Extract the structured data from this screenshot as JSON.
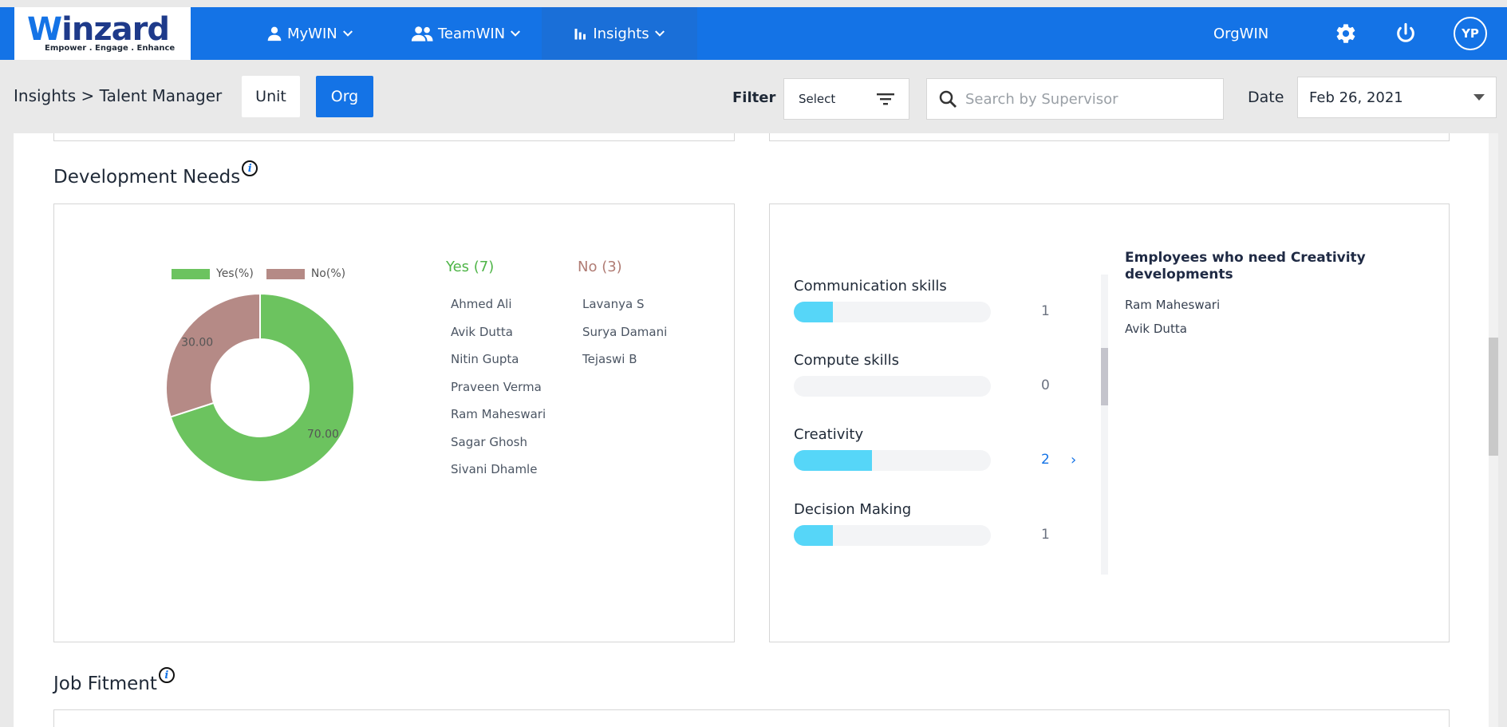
{
  "brand": {
    "name_first": "W",
    "name_rest": "inzard",
    "tagline": "Empower . Engage . Enhance"
  },
  "nav": {
    "mywin": "MyWIN",
    "teamwin": "TeamWIN",
    "insights": "Insights",
    "orgwin": "OrgWIN",
    "avatar_initials": "YP"
  },
  "subheader": {
    "breadcrumb": "Insights > Talent Manager",
    "unit_label": "Unit",
    "org_label": "Org",
    "filter_label": "Filter",
    "filter_value": "Select",
    "search_placeholder": "Search by Supervisor",
    "date_label": "Date",
    "date_value": "Feb 26, 2021"
  },
  "development_needs": {
    "title": "Development Needs",
    "legend_yes": "Yes(%)",
    "legend_no": "No(%)",
    "yes_header": "Yes (7)",
    "no_header": "No (3)",
    "yes_names": [
      "Ahmed Ali",
      "Avik Dutta",
      "Nitin Gupta",
      "Praveen Verma",
      "Ram Maheswari",
      "Sagar Ghosh",
      "Sivani Dhamle"
    ],
    "no_names": [
      "Lavanya S",
      "Surya Damani",
      "Tejaswi B"
    ],
    "skills": [
      {
        "label": "Communication skills",
        "count": "1",
        "fill": 0.5
      },
      {
        "label": "Compute skills",
        "count": "0",
        "fill": 0
      },
      {
        "label": "Creativity",
        "count": "2",
        "fill": 1.0
      },
      {
        "label": "Decision Making",
        "count": "1",
        "fill": 0.5
      }
    ],
    "employees_title": "Employees who need Creativity developments",
    "employees": [
      "Ram Maheswari",
      "Avik Dutta"
    ]
  },
  "job_fitment": {
    "title": "Job Fitment"
  },
  "colors": {
    "primary": "#1473e6",
    "yes": "#6cc35f",
    "no": "#b58a86",
    "bar": "#56d6f8",
    "yes_text": "#4fb548",
    "no_text": "#b07c74"
  },
  "chart_data": {
    "type": "pie",
    "categories": [
      "Yes(%)",
      "No(%)"
    ],
    "values": [
      70.0,
      30.0
    ],
    "labels": [
      "70.00",
      "30.00"
    ]
  }
}
